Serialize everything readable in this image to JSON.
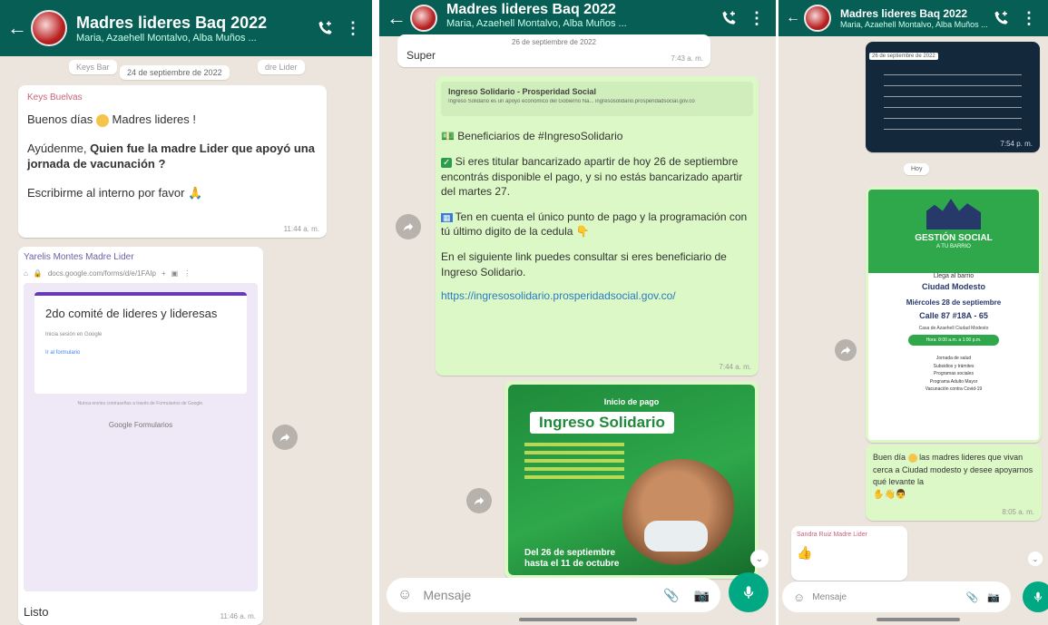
{
  "panel1": {
    "title": "Madres lideres Baq 2022",
    "subtitle": "Maria, Azaehell Montalvo, Alba Muños ...",
    "date_chip": "24 de septiembre de 2022",
    "peek_left": "Keys Bar",
    "peek_right": "dre Lider",
    "msg1": {
      "sender": "Keys Buelvas",
      "line1": "Buenos días",
      "line1b": "Madres lideres !",
      "line2": "Ayúdenme,",
      "line2_bold": "Quien fue la madre Lider que apoyó una jornada de vacunación ?",
      "line3": "Escribirme al interno por favor",
      "time": "11:44 a. m."
    },
    "msg2": {
      "sender": "Yarelis Montes Madre Lider",
      "url": "docs.google.com/forms/d/e/1FAIp",
      "form_title": "2do comité de lideres y lideresas",
      "form_sub": "Inicia sesión en Google",
      "form_link": "Ir al formulario",
      "form_note": "Nunca envíes contraseñas a través de Formularios de Google.",
      "google_forms": "Google Formularios",
      "listo": "Listo",
      "time": "11:46 a. m."
    }
  },
  "panel2": {
    "title": "Madres lideres Baq 2022",
    "subtitle": "Maria, Azaehell Montalvo, Alba Muños ...",
    "top_date": "26 de septiembre de 2022",
    "super": "Super",
    "super_time": "7:43 a. m.",
    "link_title": "Ingreso Solidario - Prosperidad Social",
    "link_desc": "Ingreso Solidario es un apoyo económico del Gobierno Na... ingresosolidario.prosperidadsocial.gov.co",
    "p1": "Beneficiarios de #IngresoSolidario",
    "p2": "Si eres titular bancarizado apartir de hoy 26 de septiembre encontrás disponible el pago, y si no estás bancarizado apartir del martes 27.",
    "p3": "Ten en cuenta el único punto de pago y la programación con tú último digito de la cedula",
    "p4": "En el siguiente link puedes consultar si eres beneficiario de Ingreso Solidario.",
    "link": "https://ingresosolidario.prosperidadsocial.gov.co/",
    "time": "7:44 a. m.",
    "img_top": "Inicio de pago",
    "img_title": "Ingreso Solidario",
    "img_bottom1": "Del 26 de septiembre",
    "img_bottom2": "hasta el 11 de octubre",
    "input_placeholder": "Mensaje"
  },
  "panel3": {
    "title": "Madres lideres Baq 2022",
    "subtitle": "Maria, Azaehell Montalvo, Alba Muños ...",
    "top_date": "26 de septiembre de 2022",
    "top_time": "7:54 p. m.",
    "small_chip": "Hoy",
    "poster_title": "GESTIÓN SOCIAL",
    "poster_sub": "A TU BARRIO",
    "poster_line1": "Llega al barrio",
    "poster_line2": "Ciudad Modesto",
    "poster_date": "Miércoles 28 de septiembre",
    "poster_address": "Calle 87 #18A - 65",
    "poster_place": "Casa de Azaehell Ciudad Modesto",
    "poster_hours": "Hora: 8:00 a.m. a 1:00 p.m.",
    "poster_items": [
      "Jornada de salud",
      "Subsidios y trámites",
      "Programas sociales",
      "Programa Adulto Mayor",
      "Vacunación contra Covid-19"
    ],
    "msg": "Buen día",
    "msg_rest": "las madres lideres que vivan cerca a Ciudad modesto y desee apoyarnos qué levante la",
    "msg_time": "8:05 a. m.",
    "sender2": "Sandra Ruiz Madre Lider",
    "input_placeholder": "Mensaje"
  }
}
